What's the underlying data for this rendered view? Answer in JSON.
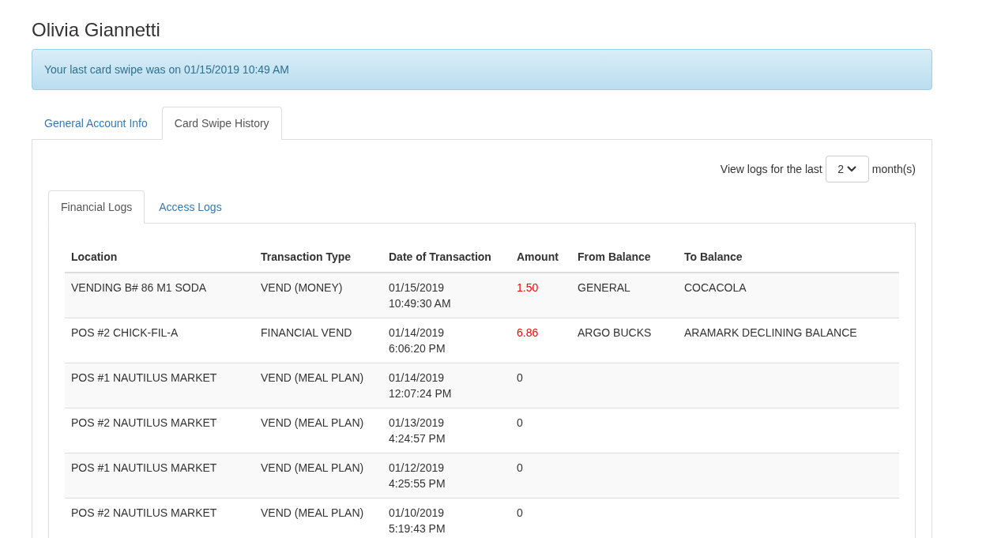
{
  "title": "Olivia Giannetti",
  "alert": "Your last card swipe was on 01/15/2019 10:49 AM",
  "tabs": [
    {
      "label": "General Account Info",
      "selected": false
    },
    {
      "label": "Card Swipe History",
      "selected": true
    }
  ],
  "filter": {
    "prefix": "View logs for the last",
    "value": "2",
    "suffix": "month(s)"
  },
  "subtabs": [
    {
      "label": "Financial Logs",
      "selected": true
    },
    {
      "label": "Access Logs",
      "selected": false
    }
  ],
  "table": {
    "columns": [
      "Location",
      "Transaction Type",
      "Date of Transaction",
      "Amount",
      "From Balance",
      "To Balance"
    ],
    "rows": [
      {
        "location": "VENDING B# 86 M1 SODA",
        "type": "VEND (MONEY)",
        "date": "01/15/2019",
        "time": "10:49:30 AM",
        "amount": "1.50",
        "amount_highlighted": true,
        "from": "GENERAL",
        "to": "COCACOLA"
      },
      {
        "location": "POS #2 CHICK-FIL-A",
        "type": "FINANCIAL VEND",
        "date": "01/14/2019",
        "time": "6:06:20 PM",
        "amount": "6.86",
        "amount_highlighted": true,
        "from": "ARGO BUCKS",
        "to": "ARAMARK DECLINING BALANCE"
      },
      {
        "location": "POS #1 NAUTILUS MARKET",
        "type": "VEND (MEAL PLAN)",
        "date": "01/14/2019",
        "time": "12:07:24 PM",
        "amount": "0",
        "amount_highlighted": false
      },
      {
        "location": "POS #2 NAUTILUS MARKET",
        "type": "VEND (MEAL PLAN)",
        "date": "01/13/2019",
        "time": "4:24:57 PM",
        "amount": "0",
        "amount_highlighted": false
      },
      {
        "location": "POS #1 NAUTILUS MARKET",
        "type": "VEND (MEAL PLAN)",
        "date": "01/12/2019",
        "time": "4:25:55 PM",
        "amount": "0",
        "amount_highlighted": false
      },
      {
        "location": "POS #2 NAUTILUS MARKET",
        "type": "VEND (MEAL PLAN)",
        "date": "01/10/2019",
        "time": "5:19:43 PM",
        "amount": "0",
        "amount_highlighted": false
      }
    ]
  }
}
